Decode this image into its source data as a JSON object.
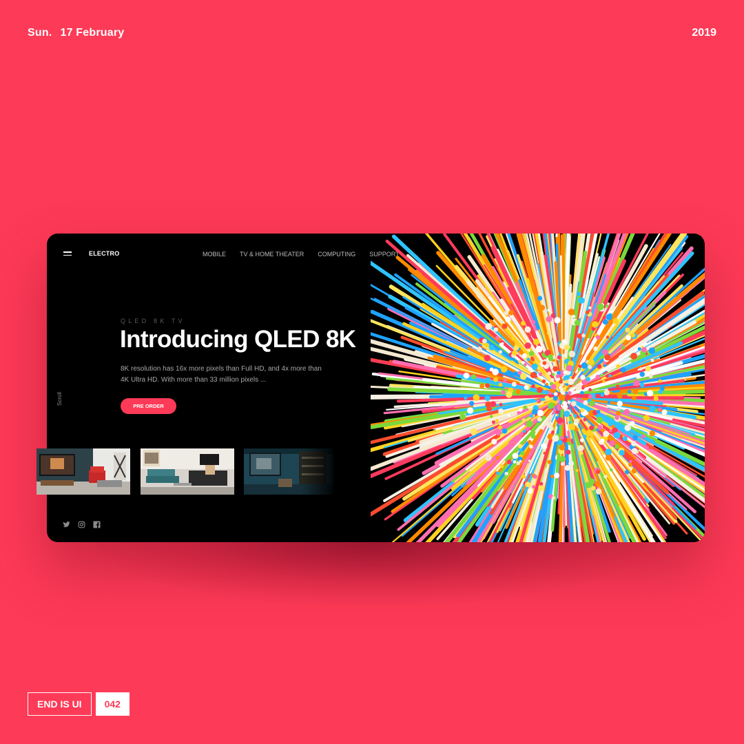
{
  "header": {
    "day": "Sun.",
    "date": "17 February",
    "year": "2019"
  },
  "site": {
    "logo": "ELECTRO",
    "nav": [
      "MOBILE",
      "TV & HOME THEATER",
      "COMPUTING",
      "SUPPORT",
      "..."
    ],
    "menu_icon": "hamburger-menu-icon"
  },
  "hero": {
    "eyebrow": "QLED 8K TV",
    "title": "Introducing QLED 8K",
    "description": "8K resolution has 16x more pixels than Full HD, and 4x more than 4K Ultra HD. With more than 33 million pixels ...",
    "cta": "PRE ORDER",
    "scroll_label": "Scroll"
  },
  "social_icons": [
    "twitter-icon",
    "instagram-icon",
    "facebook-icon"
  ],
  "thumbnails": [
    "living-room-thumbnail-1",
    "living-room-thumbnail-2",
    "living-room-thumbnail-3"
  ],
  "footer": {
    "series": "END IS UI",
    "number": "042"
  },
  "colors": {
    "background": "#fd3a57",
    "card": "#000000",
    "accent": "#fd3a57",
    "text": "#ffffff"
  }
}
